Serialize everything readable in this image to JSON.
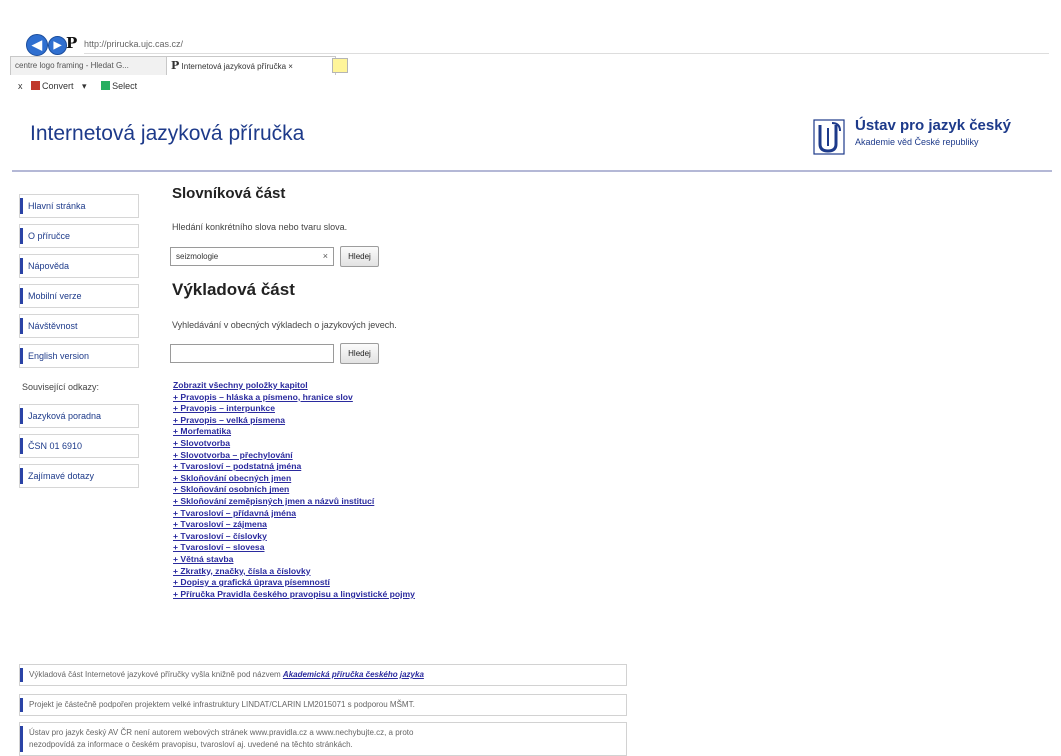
{
  "browser": {
    "address": "http://prirucka.ujc.cas.cz/",
    "favicon_letter": "P",
    "tabs": [
      "centre logo framing - Hledat G...",
      "Internetová jazyková příručka"
    ],
    "tab_close": "×",
    "toolbar": {
      "close": "x",
      "convert": "Convert",
      "convert_arrow": "▾",
      "select": "Select"
    }
  },
  "header": {
    "title": "Internetová jazyková příručka",
    "institute_name": "Ústav pro jazyk český",
    "institute_sub": "Akademie věd České republiky"
  },
  "sidebar": {
    "items": [
      "Hlavní stránka",
      "O příručce",
      "Nápověda",
      "Mobilní verze",
      "Návštěvnost",
      "English version"
    ],
    "related_label": "Související odkazy:",
    "related": [
      "Jazyková poradna",
      "ČSN 01 6910",
      "Zajímavé dotazy"
    ]
  },
  "dictionary": {
    "heading": "Slovníková část",
    "description": "Hledání konkrétního slova nebo tvaru slova.",
    "input_value": "seizmologie",
    "clear": "×",
    "button": "Hledej"
  },
  "explanatory": {
    "heading": "Výkladová část",
    "description": "Vyhledávání v obecných výkladech o jazykových jevech.",
    "input_value": "",
    "button": "Hledej"
  },
  "chapters": [
    "Zobrazit všechny položky kapitol",
    "+ Pravopis – hláska a písmeno, hranice slov",
    "+ Pravopis – interpunkce",
    "+ Pravopis – velká písmena",
    "+ Morfematika",
    "+ Slovotvorba",
    "+ Slovotvorba – přechylování",
    "+ Tvarosloví – podstatná jména",
    "+ Skloňování obecných jmen",
    "+ Skloňování osobních jmen",
    "+ Skloňování zeměpisných jmen a názvů institucí",
    "+ Tvarosloví – přídavná jména",
    "+ Tvarosloví – zájmena",
    "+ Tvarosloví – číslovky",
    "+ Tvarosloví – slovesa",
    "+ Větná stavba",
    "+ Zkratky, značky, čísla a číslovky",
    "+ Dopisy a grafická úprava písemností",
    "+ Příručka Pravidla českého pravopisu a lingvistické pojmy"
  ],
  "footer": {
    "box1_text": "Výkladová část Internetové jazykové příručky vyšla knižně pod názvem",
    "box1_book": "Akademická příručka českého jazyka",
    "box2_text": "Projekt je částečně podpořen projektem velké infrastruktury LINDAT/CLARIN LM2015071 s podporou MŠMT.",
    "box3_line1": "Ústav pro jazyk český AV ČR není autorem webových stránek www.pravidla.cz a www.nechybujte.cz, a proto",
    "box3_line2": "nezodpovídá za informace o českém pravopisu, tvarosloví aj. uvedené na těchto stránkách."
  }
}
